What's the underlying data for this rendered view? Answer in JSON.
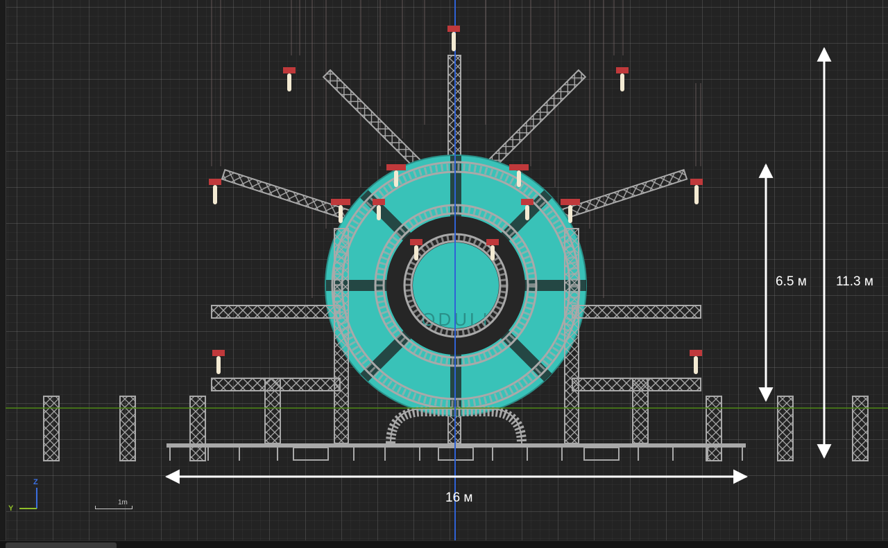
{
  "viewport": {
    "view": "front elevation",
    "grid": true,
    "colors": {
      "background": "#232323",
      "grid_major": "#5a5a5a",
      "truss": "#a9a9a9",
      "screen_teal": "#39c2b8",
      "ground_line": "#4f8a16",
      "center_axis": "#2f62d6",
      "dimension_arrows": "#ffffff",
      "fixture_red": "#c0393b"
    }
  },
  "dimensions": {
    "width": {
      "label": "16 м",
      "icon": "double-arrow-horizontal"
    },
    "height_inner": {
      "label": "6.5 м",
      "icon": "double-arrow-vertical"
    },
    "height_total": {
      "label": "11.3 м",
      "icon": "double-arrow-vertical"
    }
  },
  "stage": {
    "logo_text": "ODULI",
    "towers_count": 12,
    "spot_fixtures_count": 16
  },
  "gizmo": {
    "z_label": "Z",
    "y_label": "Y",
    "icon": "axis-gizmo-icon"
  },
  "scale": {
    "label": "1m"
  }
}
